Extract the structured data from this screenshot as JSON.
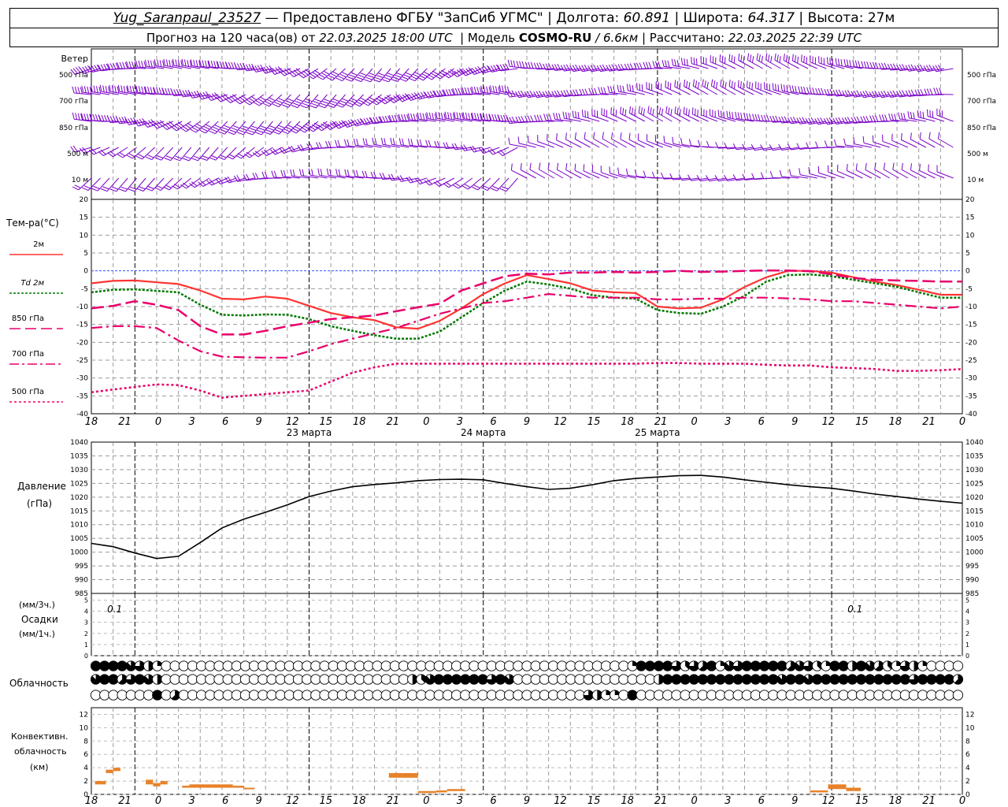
{
  "header": {
    "station": "Yug_Saranpaul_23527",
    "dash": "—",
    "provided_by": "Предоставлено ФГБУ \"ЗапСиб УГМС\"",
    "lon_label": "Долгота:",
    "lon_value": "60.891",
    "lat_label": "Широта:",
    "lat_value": "64.317",
    "alt_label": "Высота:",
    "alt_value": "27м",
    "forecast_label": "Прогноз на 120 часа(ов)  от",
    "forecast_start": "22.03.2025 18:00 UTC",
    "model_label": "Модель",
    "model_name": "COSMO-RU",
    "model_res": "/ 6.6км",
    "calc_label": "Рассчитано:",
    "calc_time": "22.03.2025 22:39 UTC"
  },
  "time_axis": {
    "hour_labels": [
      "18",
      "21",
      "0",
      "3",
      "6",
      "9",
      "12",
      "15",
      "18",
      "21",
      "0",
      "3",
      "6",
      "9",
      "12",
      "15",
      "18",
      "21",
      "0",
      "3",
      "6",
      "9",
      "12",
      "15",
      "18",
      "21",
      "0"
    ],
    "day_labels": [
      "23 марта",
      "24 марта",
      "25 марта"
    ]
  },
  "wind_panel": {
    "title": "Ветер",
    "levels": [
      "500 гПа",
      "700 гПа",
      "850 гПа",
      "500 м",
      "10  м"
    ],
    "barb_color": "#7a00c8"
  },
  "temp_panel": {
    "title": "Тем-ра(°C)",
    "yticks": [
      20,
      15,
      10,
      5,
      0,
      -5,
      -10,
      -15,
      -20,
      -25,
      -30,
      -35,
      -40
    ],
    "legend": [
      {
        "label": "2м",
        "color": "#ff3333",
        "dash": ""
      },
      {
        "label": "Td  2м",
        "color": "#007700",
        "dash": "3,2"
      },
      {
        "label": "850 гПа",
        "color": "#e8006a",
        "dash": "14,6"
      },
      {
        "label": "700 гПа",
        "color": "#e8006a",
        "dash": "12,4,3,4"
      },
      {
        "label": "500 гПа",
        "color": "#e8006a",
        "dash": "3,3"
      }
    ]
  },
  "pressure_panel": {
    "title": "Давление",
    "unit": "(гПа)",
    "yticks": [
      1040,
      1035,
      1030,
      1025,
      1020,
      1015,
      1010,
      1005,
      1000,
      995,
      990,
      985
    ]
  },
  "precip_panel": {
    "label_3h": "(мм/3ч.)",
    "title": "Осадки",
    "label_1h": "(мм/1ч.)",
    "yticks": [
      5,
      4,
      3,
      2,
      1,
      0
    ],
    "annotations": [
      {
        "text": "0.1",
        "hour": 3
      },
      {
        "text": "0.1",
        "hour": 105
      }
    ]
  },
  "cloud_panel": {
    "title": "Облачность",
    "rows": [
      "888876420000000000000000000000000000000000000000000000000000028888636582768888857632884875326420000",
      "788568740000000000000000000000000000437888888687000000000000000048888888888888788788888888888688885636",
      "000000080500000000000000000000000000000000000000000000006422080000000000000000000000000000000000000888885200000000"
    ]
  },
  "conv_panel": {
    "title_1": "Конвективн.",
    "title_2": "облачность",
    "unit": "(км)",
    "yticks": [
      12,
      10,
      8,
      6,
      4,
      2,
      0
    ],
    "color": "#e8822a"
  },
  "chart_data": [
    {
      "type": "line",
      "title": "Тем-ра(°C)",
      "x_unit": "hours from 22.03.2025 18:00 UTC",
      "x": [
        0,
        3,
        6,
        9,
        12,
        15,
        18,
        21,
        24,
        27,
        30,
        33,
        36,
        39,
        42,
        45,
        48,
        51,
        54,
        57,
        60,
        63,
        66,
        69,
        72,
        75,
        78,
        81,
        84,
        87,
        90,
        93,
        96,
        99,
        102,
        105,
        108,
        111,
        114,
        117,
        120
      ],
      "ylim": [
        -40,
        20
      ],
      "series": [
        {
          "name": "2м",
          "values": [
            -3.5,
            -2.8,
            -2.7,
            -3.2,
            -3.7,
            -5.5,
            -7.8,
            -8.0,
            -7.2,
            -7.8,
            -9.8,
            -11.8,
            -13.0,
            -13.8,
            -15.8,
            -16.2,
            -14.0,
            -10.5,
            -6.5,
            -3.5,
            -1.2,
            -2.3,
            -3.5,
            -5.5,
            -6.0,
            -6.2,
            -10.0,
            -10.5,
            -10.3,
            -8.0,
            -4.5,
            -1.8,
            0.0,
            0.0,
            -0.5,
            -1.8,
            -3.0,
            -4.0,
            -5.3,
            -6.7,
            -6.7
          ]
        },
        {
          "name": "Td  2м",
          "values": [
            -6.0,
            -5.3,
            -5.2,
            -5.6,
            -6.0,
            -9.5,
            -12.3,
            -12.5,
            -12.2,
            -12.3,
            -13.5,
            -15.5,
            -16.8,
            -18.0,
            -19.0,
            -19.0,
            -17.0,
            -13.0,
            -9.0,
            -5.5,
            -3.0,
            -3.8,
            -5.0,
            -6.8,
            -7.5,
            -7.8,
            -11.0,
            -11.8,
            -12.0,
            -10.0,
            -7.0,
            -3.0,
            -1.2,
            -1.0,
            -1.5,
            -2.5,
            -3.5,
            -4.5,
            -6.0,
            -7.5,
            -7.5
          ]
        },
        {
          "name": "850 гПа",
          "values": [
            -10.5,
            -9.8,
            -8.5,
            -9.5,
            -11.0,
            -15.5,
            -17.8,
            -17.8,
            -16.8,
            -15.5,
            -14.5,
            -13.5,
            -13.0,
            -12.5,
            -11.3,
            -10.2,
            -9.2,
            -5.5,
            -3.5,
            -1.5,
            -0.8,
            -1.0,
            -0.5,
            -0.5,
            -0.3,
            -0.5,
            -0.3,
            0.0,
            -0.3,
            -0.2,
            0.0,
            0.1,
            0.1,
            -0.1,
            -1.0,
            -2.0,
            -2.5,
            -2.7,
            -2.8,
            -3.0,
            -3.0
          ]
        },
        {
          "name": "700 гПа",
          "values": [
            -16.0,
            -15.5,
            -15.5,
            -16.0,
            -19.5,
            -22.5,
            -24.0,
            -24.2,
            -24.3,
            -24.3,
            -22.5,
            -20.5,
            -19.0,
            -17.5,
            -16.0,
            -14.0,
            -12.0,
            -10.5,
            -9.0,
            -8.5,
            -7.5,
            -6.5,
            -7.0,
            -7.5,
            -7.5,
            -7.5,
            -8.0,
            -8.0,
            -7.8,
            -7.8,
            -7.5,
            -7.5,
            -7.7,
            -8.0,
            -8.5,
            -8.5,
            -9.0,
            -9.5,
            -10.0,
            -10.5,
            -10.0
          ]
        },
        {
          "name": "500 гПа",
          "values": [
            -34.0,
            -33.2,
            -32.5,
            -31.8,
            -32.0,
            -33.5,
            -35.5,
            -35.0,
            -34.5,
            -34.0,
            -33.5,
            -31.0,
            -28.5,
            -27.0,
            -26.0,
            -26.0,
            -26.0,
            -26.0,
            -26.0,
            -26.0,
            -26.0,
            -26.0,
            -26.0,
            -26.0,
            -26.0,
            -26.0,
            -25.8,
            -25.8,
            -26.0,
            -26.0,
            -26.0,
            -26.3,
            -26.5,
            -26.5,
            -27.0,
            -27.2,
            -27.5,
            -28.0,
            -28.0,
            -27.8,
            -27.5
          ]
        }
      ]
    },
    {
      "type": "line",
      "title": "Давление",
      "ylabel": "(гПа)",
      "x_unit": "hours from 22.03.2025 18:00 UTC",
      "x": [
        0,
        3,
        6,
        9,
        12,
        15,
        18,
        21,
        24,
        27,
        30,
        33,
        36,
        39,
        42,
        45,
        48,
        51,
        54,
        57,
        60,
        63,
        66,
        69,
        72,
        75,
        78,
        81,
        84,
        87,
        90,
        93,
        96,
        99,
        102,
        105,
        108,
        111,
        114,
        117,
        120
      ],
      "ylim": [
        985,
        1040
      ],
      "series": [
        {
          "name": "",
          "values": [
            1003.2,
            1002.0,
            999.7,
            997.7,
            998.5,
            1003.5,
            1008.8,
            1012.0,
            1014.5,
            1017.2,
            1020.2,
            1022.2,
            1023.8,
            1024.6,
            1025.2,
            1026.0,
            1026.4,
            1026.5,
            1026.3,
            1025.0,
            1023.8,
            1022.8,
            1023.2,
            1024.5,
            1026.0,
            1026.8,
            1027.3,
            1027.8,
            1027.9,
            1027.3,
            1026.3,
            1025.4,
            1024.5,
            1023.8,
            1023.2,
            1022.2,
            1021.1,
            1020.2,
            1019.3,
            1018.5,
            1017.8
          ]
        }
      ]
    },
    {
      "type": "bar",
      "title": "Конвективн. облачность",
      "ylabel": "(км)",
      "x_unit": "hours from 22.03.2025 18:00 UTC",
      "ylim": [
        0,
        13
      ],
      "bars": [
        {
          "t0": 0.5,
          "t1": 2.0,
          "base": 1.5,
          "top": 2.0
        },
        {
          "t0": 2.0,
          "t1": 3.0,
          "base": 3.2,
          "top": 3.7
        },
        {
          "t0": 3.0,
          "t1": 4.0,
          "base": 3.5,
          "top": 4.0
        },
        {
          "t0": 7.5,
          "t1": 8.5,
          "base": 1.5,
          "top": 2.2
        },
        {
          "t0": 8.5,
          "t1": 9.5,
          "base": 1.2,
          "top": 1.7
        },
        {
          "t0": 9.5,
          "t1": 10.5,
          "base": 1.5,
          "top": 2.0
        },
        {
          "t0": 12.5,
          "t1": 13.5,
          "base": 1.0,
          "top": 1.3
        },
        {
          "t0": 13.5,
          "t1": 16.5,
          "base": 1.0,
          "top": 1.5
        },
        {
          "t0": 16.5,
          "t1": 19.5,
          "base": 1.0,
          "top": 1.5
        },
        {
          "t0": 19.5,
          "t1": 21.0,
          "base": 1.0,
          "top": 1.3
        },
        {
          "t0": 21.0,
          "t1": 22.5,
          "base": 0.8,
          "top": 1.0
        },
        {
          "t0": 41.0,
          "t1": 45.0,
          "base": 2.5,
          "top": 3.2
        },
        {
          "t0": 45.0,
          "t1": 47.5,
          "base": 0.2,
          "top": 0.5
        },
        {
          "t0": 47.5,
          "t1": 49.0,
          "base": 0.3,
          "top": 0.6
        },
        {
          "t0": 49.0,
          "t1": 51.5,
          "base": 0.5,
          "top": 0.8
        },
        {
          "t0": 99.0,
          "t1": 101.5,
          "base": 0.3,
          "top": 0.6
        },
        {
          "t0": 101.5,
          "t1": 104.0,
          "base": 0.8,
          "top": 1.5
        },
        {
          "t0": 104.0,
          "t1": 106.0,
          "base": 0.5,
          "top": 1.0
        }
      ]
    }
  ]
}
